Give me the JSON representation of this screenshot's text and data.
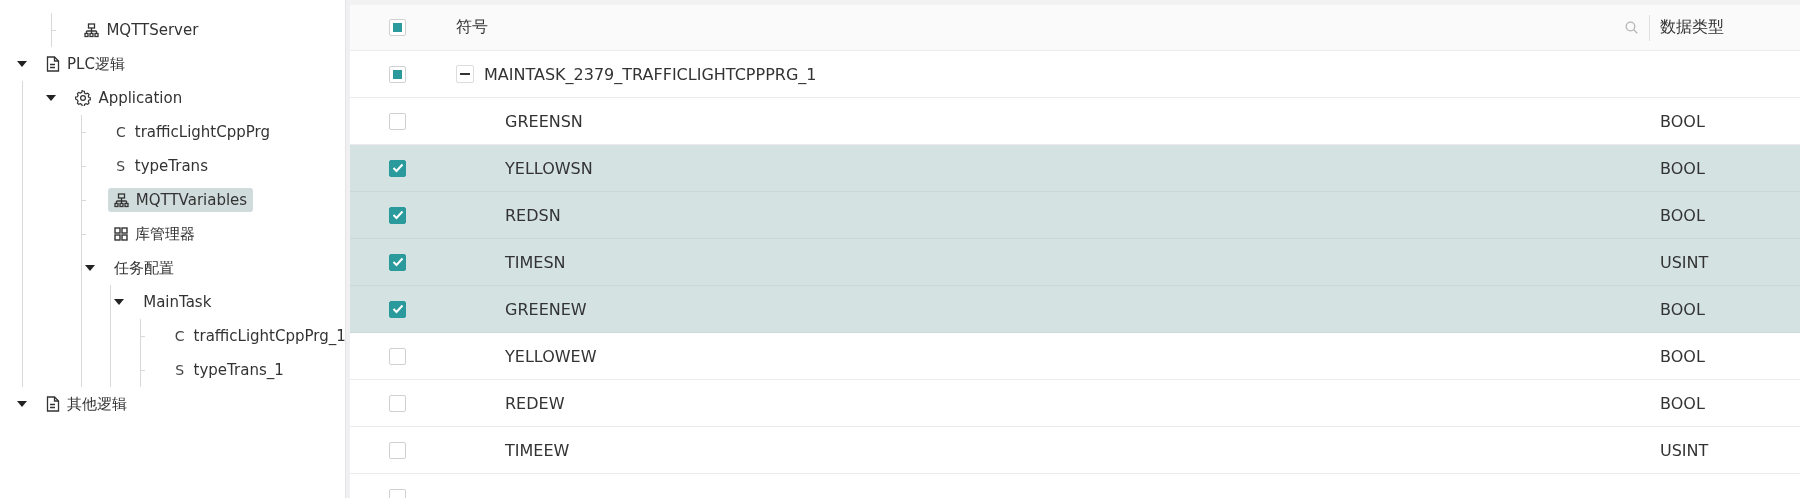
{
  "tree": [
    {
      "children": [
        {
          "label": "MQTTServer",
          "kind": "network",
          "selected": false
        }
      ]
    },
    {
      "label": "PLC逻辑",
      "kind": "document",
      "expanded": true,
      "selected": false,
      "children": [
        {
          "label": "Application",
          "kind": "gear",
          "expanded": true,
          "selected": false,
          "children": [
            {
              "label": "trafficLightCppPrg",
              "badge": "C",
              "selected": false
            },
            {
              "label": "typeTrans",
              "badge": "S",
              "selected": false
            },
            {
              "label": "MQTTVariables",
              "kind": "network",
              "selected": true
            },
            {
              "label": "库管理器",
              "kind": "grid",
              "selected": false
            },
            {
              "label": "任务配置",
              "expanded": true,
              "selected": false,
              "children": [
                {
                  "label": "MainTask",
                  "expanded": true,
                  "selected": false,
                  "children": [
                    {
                      "label": "trafficLightCppPrg_1",
                      "badge": "C",
                      "selected": false
                    },
                    {
                      "label": "typeTrans_1",
                      "badge": "S",
                      "selected": false
                    }
                  ]
                }
              ]
            }
          ]
        }
      ]
    },
    {
      "label": "其他逻辑",
      "kind": "document",
      "expanded": true,
      "selected": false
    }
  ],
  "table": {
    "columns": [
      "符号",
      "数据类型"
    ],
    "select_all": {
      "checked": false,
      "indeterminate": true
    },
    "group": {
      "label": "MAINTASK_2379_TRAFFICLIGHTCPPPRG_1",
      "expanded": true,
      "checked": false,
      "indeterminate": true
    },
    "rows": [
      {
        "symbol": "GREENSN",
        "data_type": "BOOL",
        "checked": false
      },
      {
        "symbol": "YELLOWSN",
        "data_type": "BOOL",
        "checked": true
      },
      {
        "symbol": "REDSN",
        "data_type": "BOOL",
        "checked": true
      },
      {
        "symbol": "TIMESN",
        "data_type": "USINT",
        "checked": true
      },
      {
        "symbol": "GREENEW",
        "data_type": "BOOL",
        "checked": true
      },
      {
        "symbol": "YELLOWEW",
        "data_type": "BOOL",
        "checked": false
      },
      {
        "symbol": "REDEW",
        "data_type": "BOOL",
        "checked": false
      },
      {
        "symbol": "TIMEEW",
        "data_type": "USINT",
        "checked": false
      },
      {
        "checked": false
      }
    ]
  }
}
